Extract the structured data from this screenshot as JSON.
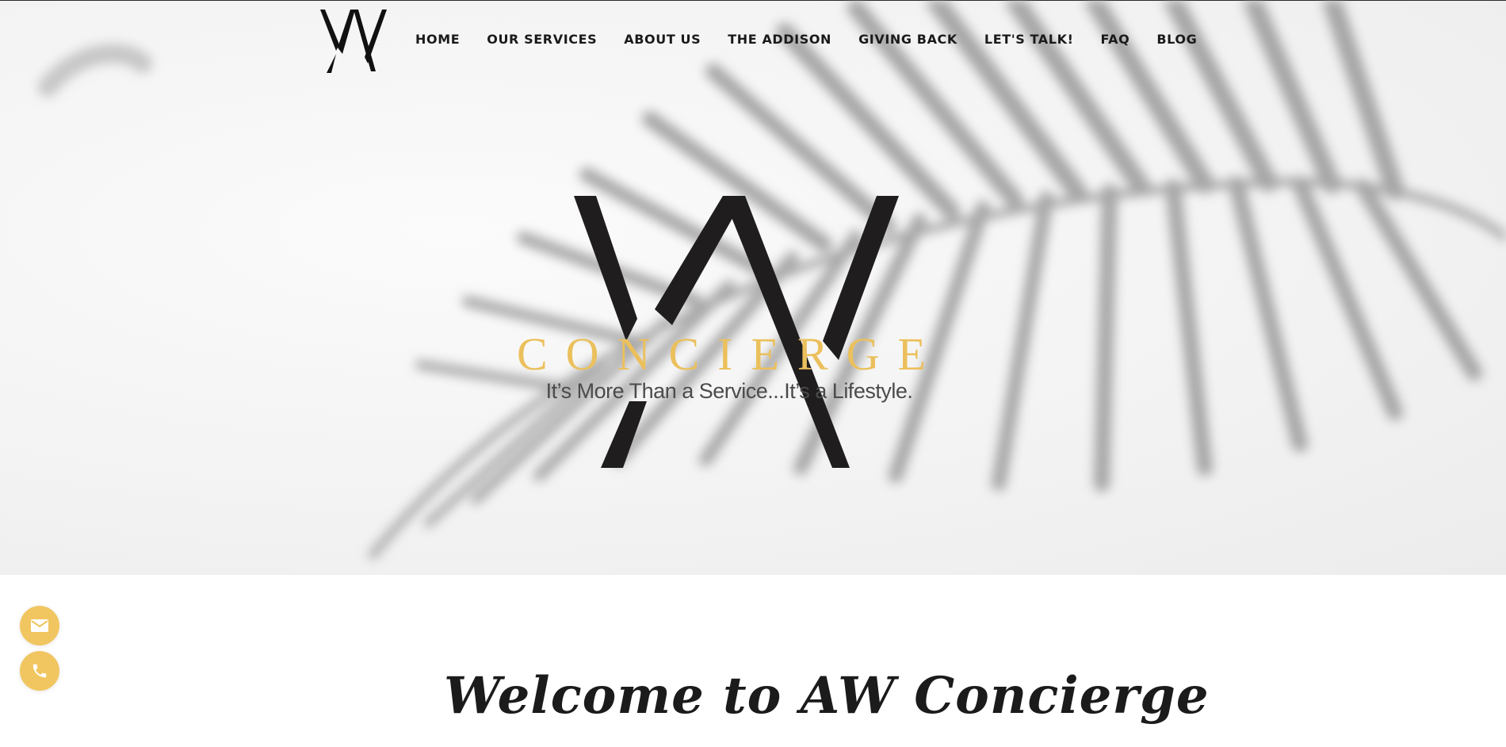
{
  "nav": {
    "items": [
      {
        "label": "HOME"
      },
      {
        "label": "OUR SERVICES"
      },
      {
        "label": "ABOUT US"
      },
      {
        "label": "THE ADDISON"
      },
      {
        "label": "GIVING BACK"
      },
      {
        "label": "LET'S TALK!"
      },
      {
        "label": "FAQ"
      },
      {
        "label": "BLOG"
      }
    ],
    "logo_icon": "aw-monogram-icon"
  },
  "hero": {
    "logo_icon": "aw-monogram-icon",
    "brand": "CONCIERGE",
    "tagline": "It’s More Than a Service...It’s a Lifestyle.",
    "brand_color": "#ebc05c",
    "background_decor": "palm-leaf-shadow"
  },
  "contact": {
    "email_icon": "envelope-icon",
    "phone_icon": "phone-icon",
    "accent_color": "#f1c660"
  },
  "welcome": {
    "heading": "Welcome to AW Concierge"
  }
}
